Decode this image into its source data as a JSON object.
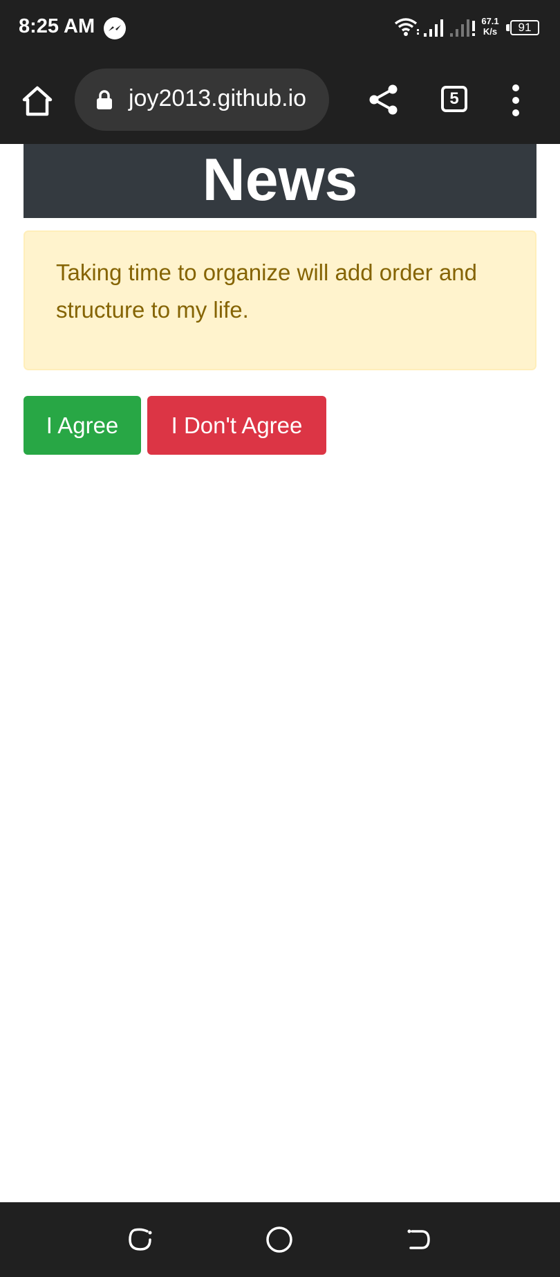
{
  "status_bar": {
    "time": "8:25 AM",
    "net_speed_value": "67.1",
    "net_speed_unit": "K/s",
    "battery": "91",
    "icons": [
      "messenger-icon",
      "wifi-icon",
      "signal-icon",
      "signal-icon",
      "battery-icon"
    ]
  },
  "browser": {
    "url": "joy2013.github.io",
    "tab_count": "5",
    "icons": [
      "home-icon",
      "lock-icon",
      "share-icon",
      "tabs-icon",
      "more-vert-icon"
    ]
  },
  "page": {
    "title": "News",
    "message": "Taking time to organize will add order and structure to my life.",
    "agree_label": "I Agree",
    "disagree_label": "I Don't Agree",
    "colors": {
      "header_bg": "#343a40",
      "alert_bg": "#fff3cd",
      "alert_text": "#856404",
      "agree": "#28a745",
      "disagree": "#dc3545"
    }
  },
  "nav_bar": {
    "icons": [
      "recents-icon",
      "home-circle-icon",
      "back-icon"
    ]
  }
}
